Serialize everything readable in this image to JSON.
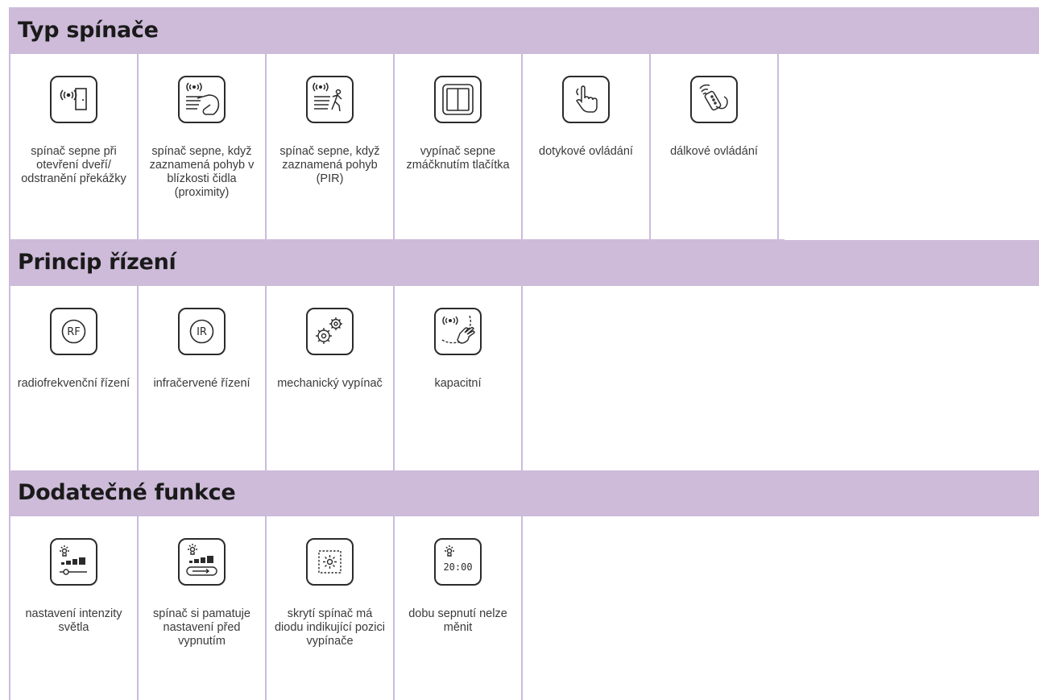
{
  "sections": [
    {
      "title": "Typ spínače",
      "items": [
        {
          "icon": "wireless-door-icon",
          "label": "spínač sepne při otevření dveří/ odstranění překážky"
        },
        {
          "icon": "wireless-hand-proximity-icon",
          "label": "spínač sepne, když zaznamená pohyb v blízkosti čidla (proximity)"
        },
        {
          "icon": "wireless-motion-pir-icon",
          "label": "spínač sepne, když zaznamená pohyb (PIR)"
        },
        {
          "icon": "push-button-switch-icon",
          "label": "vypínač sepne zmáčknutím tlačítka"
        },
        {
          "icon": "touch-control-icon",
          "label": "dotykové ovládání"
        },
        {
          "icon": "remote-control-icon",
          "label": "dálkové ovládání"
        }
      ]
    },
    {
      "title": "Princip řízení",
      "items": [
        {
          "icon": "rf-icon",
          "icon_text": "RF",
          "label": "radiofrekvenční řízení"
        },
        {
          "icon": "ir-icon",
          "icon_text": "IR",
          "label": "infračervené řízení"
        },
        {
          "icon": "gears-icon",
          "label": "mechanický vypínač"
        },
        {
          "icon": "capacitive-icon",
          "label": "kapacitní"
        }
      ]
    },
    {
      "title": "Dodatečné funkce",
      "items": [
        {
          "icon": "light-dimmer-slider-icon",
          "label": "nastavení intenzity světla"
        },
        {
          "icon": "light-memory-icon",
          "label": "spínač si pamatuje nastavení před vypnutím"
        },
        {
          "icon": "hidden-switch-led-icon",
          "label": "skrytí spínač má diodu indikující pozici vypínače"
        },
        {
          "icon": "timer-icon",
          "icon_text": "20:00",
          "label": "dobu sepnutí nelze měnit"
        }
      ]
    }
  ],
  "colors": {
    "header_bg": "#cdbbd9",
    "line": "#cdbbd9",
    "icon_stroke": "#2b2b2b"
  }
}
